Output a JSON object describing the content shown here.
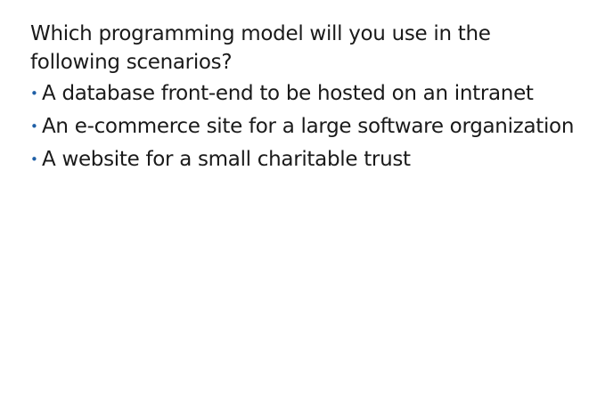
{
  "slide": {
    "question": "Which programming model will you use in the following scenarios?",
    "bullet_symbol": "•",
    "accent_color": "#1f5fa6",
    "items": [
      {
        "label": "A database front-end to be hosted on an intranet"
      },
      {
        "label": "An e-commerce site for a large software organization"
      },
      {
        "label": "A website for a small charitable trust"
      }
    ]
  }
}
